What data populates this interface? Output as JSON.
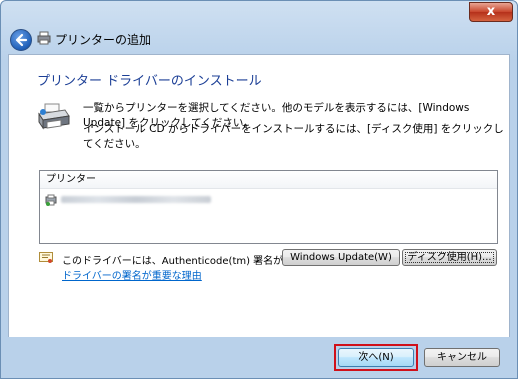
{
  "window": {
    "title": "プリンターの追加",
    "close_label": "x"
  },
  "page": {
    "heading": "プリンター ドライバーのインストール",
    "description_line1": "一覧からプリンターを選択してください。他のモデルを表示するには、[Windows Update] をクリックしてください。",
    "description_line2": "インストール CD からドライバーをインストールするには、[ディスク使用] をクリックしてください。"
  },
  "printer_list": {
    "header": "プリンター",
    "items": [
      {
        "icon": "printer-icon"
      }
    ]
  },
  "signature": {
    "text": "このドライバーには、Authenticode(tm) 署名があります。",
    "link": "ドライバーの署名が重要な理由"
  },
  "buttons": {
    "windows_update": "Windows Update(W)",
    "have_disk": "ディスク使用(H)...",
    "next": "次へ(N)",
    "cancel": "キャンセル"
  },
  "colors": {
    "heading": "#1c3f96",
    "link": "#0066cc",
    "highlight_frame": "#d0101a"
  }
}
